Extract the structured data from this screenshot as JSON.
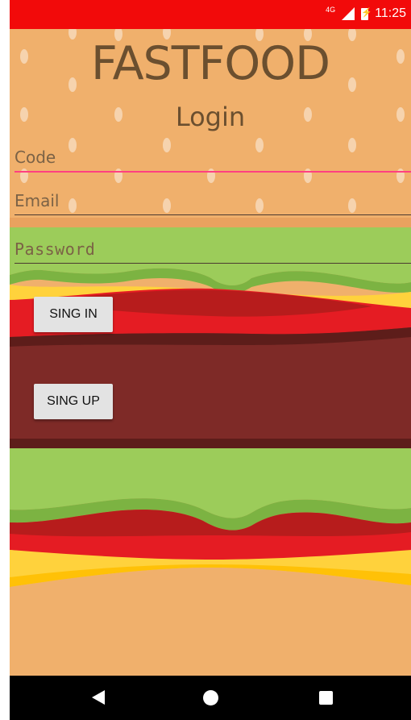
{
  "status_bar": {
    "network": "4G",
    "time": "11:25",
    "icons": [
      "signal-icon",
      "battery-charging-icon"
    ]
  },
  "header": {
    "title": "FASTFOOD",
    "subtitle": "Login"
  },
  "form": {
    "code_placeholder": "Code",
    "email_placeholder": "Email",
    "password_placeholder": "Password"
  },
  "buttons": {
    "sign_in_label": "SING IN",
    "sign_up_label": "SING UP"
  },
  "navbar": {
    "icons": [
      "back-icon",
      "home-icon",
      "recents-icon"
    ]
  },
  "colors": {
    "status_bar": "#f20a0a",
    "bun": "#f0b06c",
    "lettuce": "#9ccc5a",
    "cheese": "#ffd23c",
    "tomato": "#e51c23",
    "patty": "#7e2a27",
    "accent": "#ff4081"
  }
}
